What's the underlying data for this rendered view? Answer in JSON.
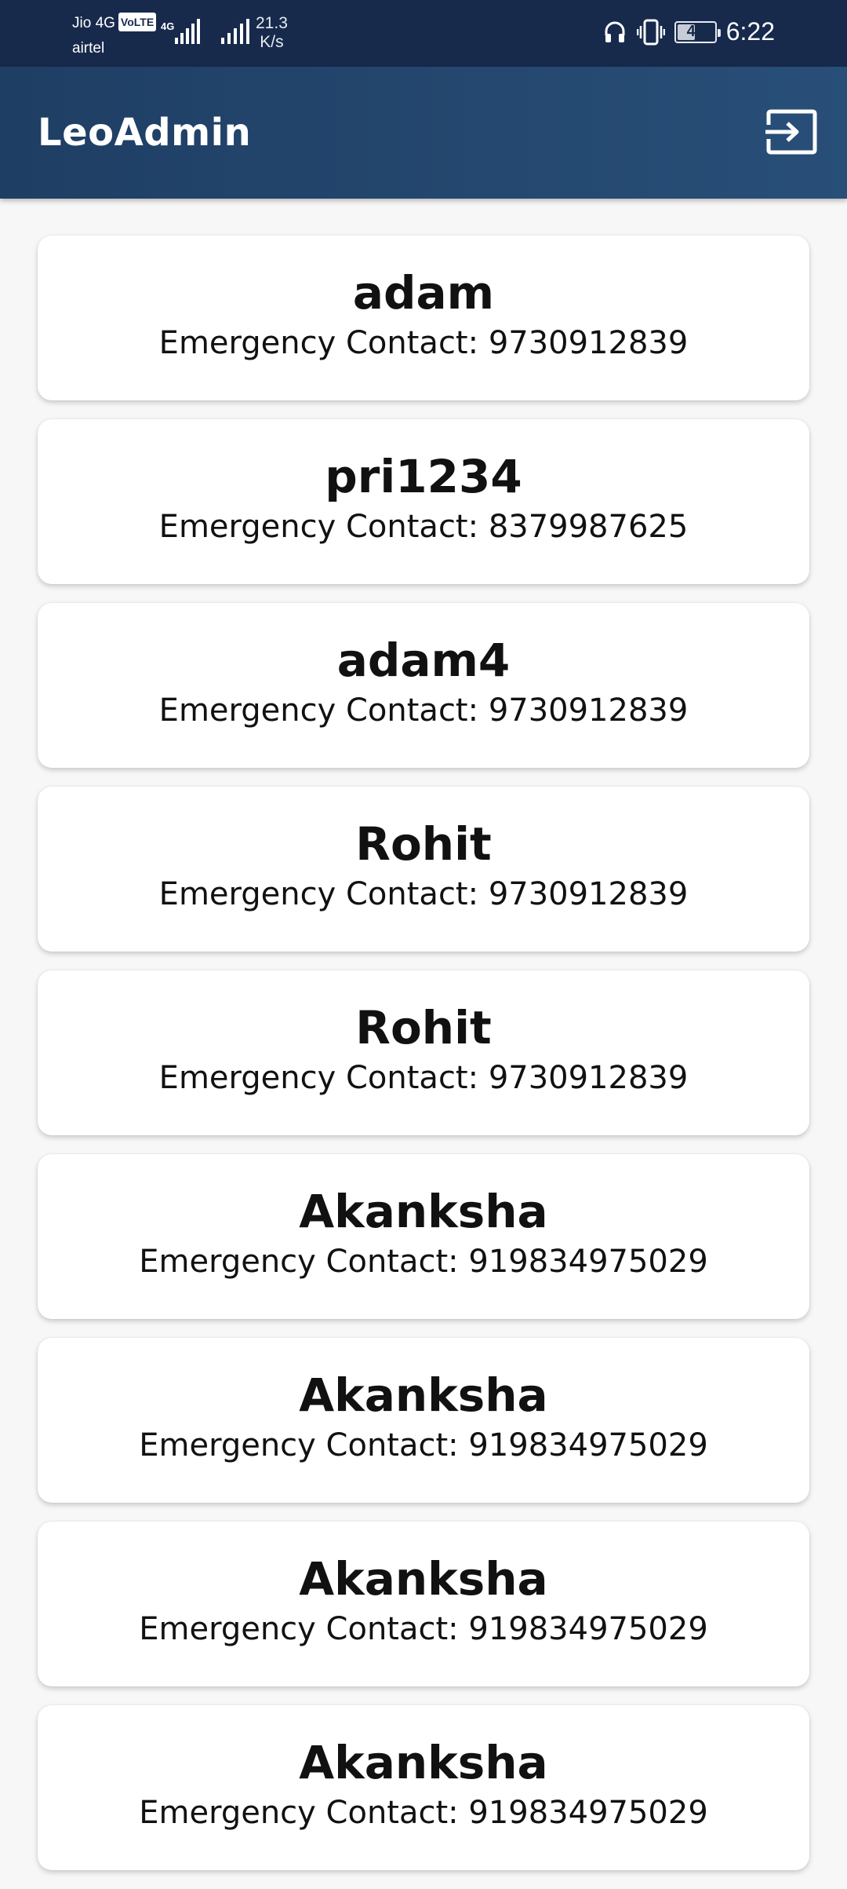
{
  "status_bar": {
    "carrier_1": "Jio 4G",
    "volte": "VoLTE",
    "network_type": "4G",
    "carrier_2": "airtel",
    "speed_value": "21.3",
    "speed_unit": "K/s",
    "battery_level": "44",
    "time": "6:22",
    "icons": [
      "headphones-icon",
      "vibrate-icon",
      "battery-icon"
    ]
  },
  "app_bar": {
    "title": "LeoAdmin",
    "logout_icon": "logout-icon"
  },
  "users": [
    {
      "name": "adam",
      "contact_label": "Emergency Contact: ",
      "contact": "9730912839"
    },
    {
      "name": "pri1234",
      "contact_label": "Emergency Contact: ",
      "contact": "8379987625"
    },
    {
      "name": "adam4",
      "contact_label": "Emergency Contact: ",
      "contact": "9730912839"
    },
    {
      "name": "Rohit",
      "contact_label": "Emergency Contact: ",
      "contact": "9730912839"
    },
    {
      "name": "Rohit",
      "contact_label": "Emergency Contact: ",
      "contact": "9730912839"
    },
    {
      "name": "Akanksha",
      "contact_label": "Emergency Contact: ",
      "contact": "919834975029"
    },
    {
      "name": "Akanksha",
      "contact_label": "Emergency Contact: ",
      "contact": "919834975029"
    },
    {
      "name": "Akanksha",
      "contact_label": "Emergency Contact: ",
      "contact": "919834975029"
    },
    {
      "name": "Akanksha",
      "contact_label": "Emergency Contact: ",
      "contact": "919834975029"
    }
  ],
  "colors": {
    "status_bar": "#172a4c",
    "app_bar": "#254a72",
    "background": "#f7f7f7",
    "card": "#ffffff"
  }
}
